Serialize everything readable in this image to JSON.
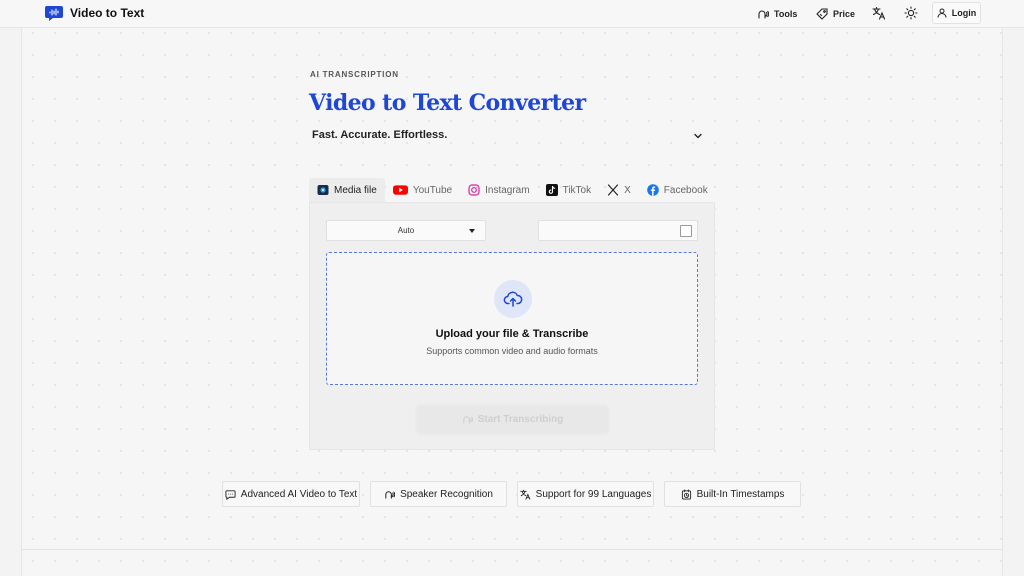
{
  "header": {
    "brand": "Video to Text",
    "logo_icon": "speech-bubble-waveform-icon",
    "nav": [
      {
        "label": "Tools",
        "icon": "voice-head-icon"
      },
      {
        "label": "Price",
        "icon": "price-tag-icon"
      }
    ],
    "language_icon": "translate-icon",
    "theme_icon": "sun-icon",
    "login_label": "Login",
    "login_icon": "user-icon"
  },
  "hero": {
    "eyebrow": "AI TRANSCRIPTION",
    "title": "Video to Text Converter",
    "subtitle": "Fast. Accurate. Effortless."
  },
  "tabs": [
    {
      "label": "Media file",
      "icon": "media-file-icon",
      "active": true
    },
    {
      "label": "YouTube",
      "icon": "youtube-icon"
    },
    {
      "label": "Instagram",
      "icon": "instagram-icon"
    },
    {
      "label": "TikTok",
      "icon": "tiktok-icon"
    },
    {
      "label": "X",
      "icon": "x-icon"
    },
    {
      "label": "Facebook",
      "icon": "facebook-icon"
    }
  ],
  "panel": {
    "language_select": "Auto",
    "upload_title": "Upload your file & Transcribe",
    "upload_subtitle": "Supports common video and audio formats",
    "start_label": "Start Transcribing"
  },
  "features": [
    {
      "label": "Advanced AI Video to Text",
      "icon": "ai-chat-icon"
    },
    {
      "label": "Speaker Recognition",
      "icon": "voice-head-icon"
    },
    {
      "label": "Support for 99 Languages",
      "icon": "translate-icon"
    },
    {
      "label": "Built-In Timestamps",
      "icon": "clock-icon"
    }
  ],
  "colors": {
    "accent": "#1f47d6",
    "dropzone_border": "#5577e0",
    "youtube": "#ff0000",
    "facebook": "#1877f2"
  }
}
